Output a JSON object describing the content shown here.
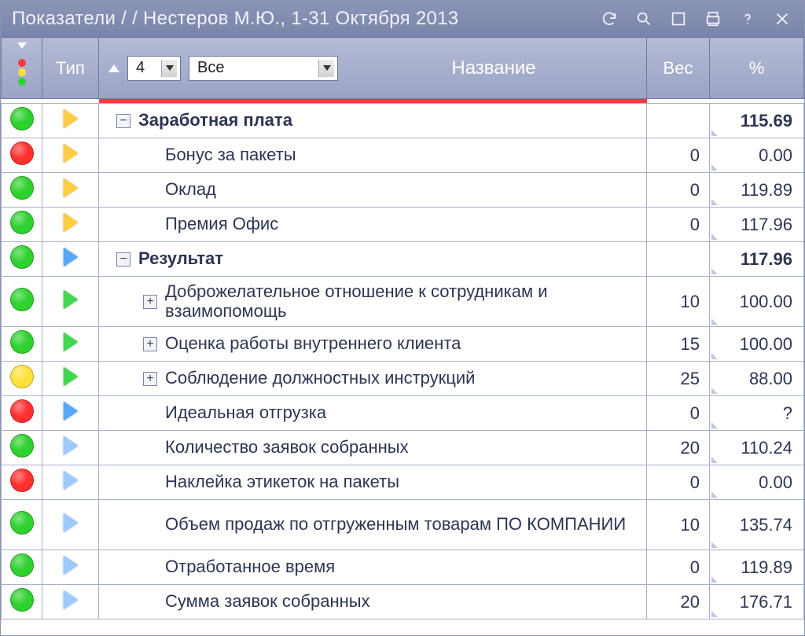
{
  "titlebar": {
    "title": "Показатели / / Нестеров М.Ю., 1-31 Октября 2013"
  },
  "header": {
    "type_label": "Тип",
    "level_value": "4",
    "filter_value": "Все",
    "name_label": "Название",
    "weight_label": "Вес",
    "percent_label": "%"
  },
  "rows": [
    {
      "status": "green",
      "type": "yellow",
      "indent": 1,
      "expander": "minus",
      "name": "Заработная плата",
      "weight": "",
      "pct": "115.69",
      "bold": true,
      "multiline": false
    },
    {
      "status": "red",
      "type": "yellow",
      "indent": 2,
      "expander": "",
      "name": "Бонус за пакеты",
      "weight": "0",
      "pct": "0.00",
      "bold": false,
      "multiline": false
    },
    {
      "status": "green",
      "type": "yellow",
      "indent": 2,
      "expander": "",
      "name": "Оклад",
      "weight": "0",
      "pct": "119.89",
      "bold": false,
      "multiline": false
    },
    {
      "status": "green",
      "type": "yellow",
      "indent": 2,
      "expander": "",
      "name": "Премия Офис",
      "weight": "0",
      "pct": "117.96",
      "bold": false,
      "multiline": false
    },
    {
      "status": "green",
      "type": "blue",
      "indent": 1,
      "expander": "minus",
      "name": "Результат",
      "weight": "",
      "pct": "117.96",
      "bold": true,
      "multiline": false
    },
    {
      "status": "green",
      "type": "green",
      "indent": 3,
      "expander": "plus",
      "name": "Доброжелательное отношение к сотрудникам и взаимопомощь",
      "weight": "10",
      "pct": "100.00",
      "bold": false,
      "multiline": true
    },
    {
      "status": "green",
      "type": "green",
      "indent": 3,
      "expander": "plus",
      "name": "Оценка работы внутреннего клиента",
      "weight": "15",
      "pct": "100.00",
      "bold": false,
      "multiline": false
    },
    {
      "status": "yellow",
      "type": "green",
      "indent": 3,
      "expander": "plus",
      "name": "Соблюдение должностных инструкций",
      "weight": "25",
      "pct": "88.00",
      "bold": false,
      "multiline": false
    },
    {
      "status": "red",
      "type": "blue",
      "indent": 2,
      "expander": "",
      "name": "Идеальная отгрузка",
      "weight": "0",
      "pct": "?",
      "bold": false,
      "multiline": false,
      "pct_red": true
    },
    {
      "status": "green",
      "type": "lblue",
      "indent": 2,
      "expander": "",
      "name": "Количество заявок собранных",
      "weight": "20",
      "pct": "110.24",
      "bold": false,
      "multiline": false
    },
    {
      "status": "red",
      "type": "lblue",
      "indent": 2,
      "expander": "",
      "name": "Наклейка этикеток на пакеты",
      "weight": "0",
      "pct": "0.00",
      "bold": false,
      "multiline": false
    },
    {
      "status": "green",
      "type": "lblue",
      "indent": 2,
      "expander": "",
      "name": "Объем продаж по отгруженным товарам ПО КОМПАНИИ",
      "weight": "10",
      "pct": "135.74",
      "bold": false,
      "multiline": true
    },
    {
      "status": "green",
      "type": "lblue",
      "indent": 2,
      "expander": "",
      "name": "Отработанное время",
      "weight": "0",
      "pct": "119.89",
      "bold": false,
      "multiline": false
    },
    {
      "status": "green",
      "type": "lblue",
      "indent": 2,
      "expander": "",
      "name": "Сумма заявок собранных",
      "weight": "20",
      "pct": "176.71",
      "bold": false,
      "multiline": false
    }
  ]
}
